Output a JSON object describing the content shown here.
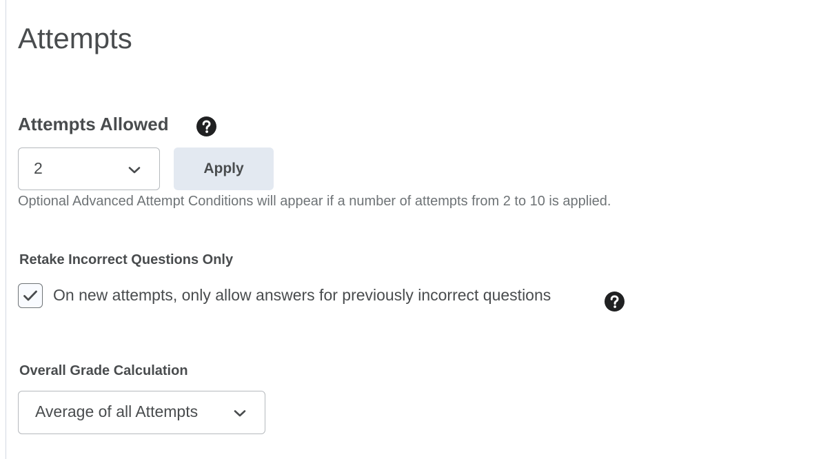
{
  "page": {
    "title": "Attempts"
  },
  "attempts_allowed": {
    "heading": "Attempts Allowed",
    "help_icon": "question-circle-icon",
    "select_value": "2",
    "apply_label": "Apply",
    "hint": "Optional Advanced Attempt Conditions will appear if a number of attempts from 2 to 10 is applied."
  },
  "retake": {
    "label": "Retake Incorrect Questions Only",
    "checkbox_checked": true,
    "checkbox_label": "On new attempts, only allow answers for previously incorrect questions",
    "help_icon": "question-circle-icon"
  },
  "grade_calculation": {
    "label": "Overall Grade Calculation",
    "select_value": "Average of all Attempts"
  },
  "colors": {
    "text": "#494c4e",
    "hint_text": "#6e7376",
    "apply_bg": "#e3e9f1",
    "border": "#b5b9bd",
    "help_icon_bg": "#202122"
  }
}
